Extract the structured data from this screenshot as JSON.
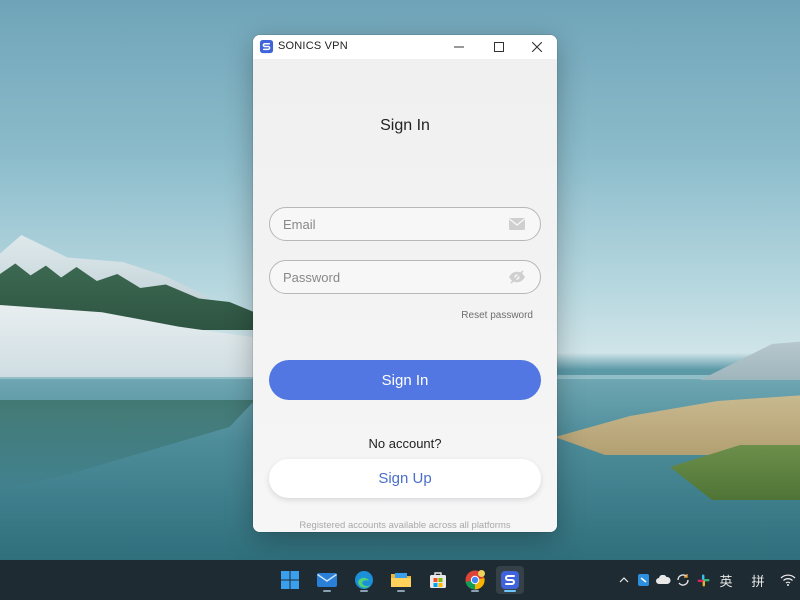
{
  "window": {
    "title": "SONICS VPN",
    "controls": {
      "minimize": "minimize",
      "maximize": "maximize",
      "close": "close"
    }
  },
  "signin": {
    "heading": "Sign In",
    "email_placeholder": "Email",
    "password_placeholder": "Password",
    "reset_label": "Reset password",
    "signin_button": "Sign In",
    "no_account": "No account?",
    "signup_button": "Sign Up",
    "footnote": "Registered accounts available across all platforms"
  },
  "colors": {
    "accent": "#5277e3",
    "signup_text": "#4a6fc9",
    "taskbar": "#1f2b33"
  },
  "taskbar": {
    "apps": [
      {
        "name": "start",
        "icon": "windows-logo-icon"
      },
      {
        "name": "mail",
        "icon": "mail-icon"
      },
      {
        "name": "edge",
        "icon": "edge-browser-icon"
      },
      {
        "name": "file-explorer",
        "icon": "folder-icon"
      },
      {
        "name": "store",
        "icon": "store-icon"
      },
      {
        "name": "chrome",
        "icon": "chrome-icon"
      },
      {
        "name": "sonics-vpn",
        "icon": "sonics-vpn-icon",
        "active": true
      }
    ],
    "tray": {
      "lang_1": "英",
      "lang_2": "拼"
    }
  }
}
